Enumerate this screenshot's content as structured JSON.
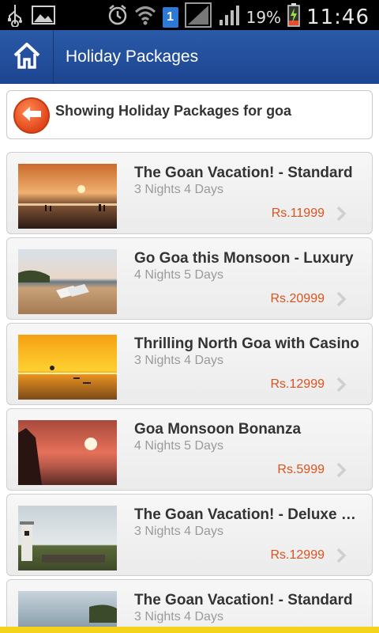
{
  "status_bar": {
    "sim_number": "1",
    "battery_percent": "19%",
    "time": "11:46",
    "icons": [
      "usb-icon",
      "image-icon",
      "alarm-icon",
      "wifi-icon",
      "sim-icon",
      "signal-icon",
      "battery-icon"
    ]
  },
  "action_bar": {
    "title": "Holiday Packages",
    "home_icon": "home-icon",
    "color": "#2552a0"
  },
  "header": {
    "back_icon": "back-arrow-icon",
    "text": "Showing Holiday Packages for goa"
  },
  "packages": [
    {
      "title": "The Goan Vacation! - Standard",
      "duration": "3 Nights 4 Days",
      "price": "Rs.11999"
    },
    {
      "title": "Go Goa this Monsoon - Luxury",
      "duration": "4 Nights 5 Days",
      "price": "Rs.20999"
    },
    {
      "title": "Thrilling North Goa with Casino",
      "duration": "3 Nights 4 Days",
      "price": "Rs.12999"
    },
    {
      "title": "Goa Monsoon Bonanza",
      "duration": "4 Nights 5 Days",
      "price": "Rs.5999"
    },
    {
      "title": "The Goan Vacation! - Deluxe Package",
      "duration": "3 Nights 4 Days",
      "price": "Rs.12999"
    },
    {
      "title": "The Goan Vacation! - Standard",
      "duration": "3 Nights 4 Days",
      "price": ""
    }
  ],
  "colors": {
    "price": "#d9531e",
    "accent_bottom": "#f5d31a"
  }
}
